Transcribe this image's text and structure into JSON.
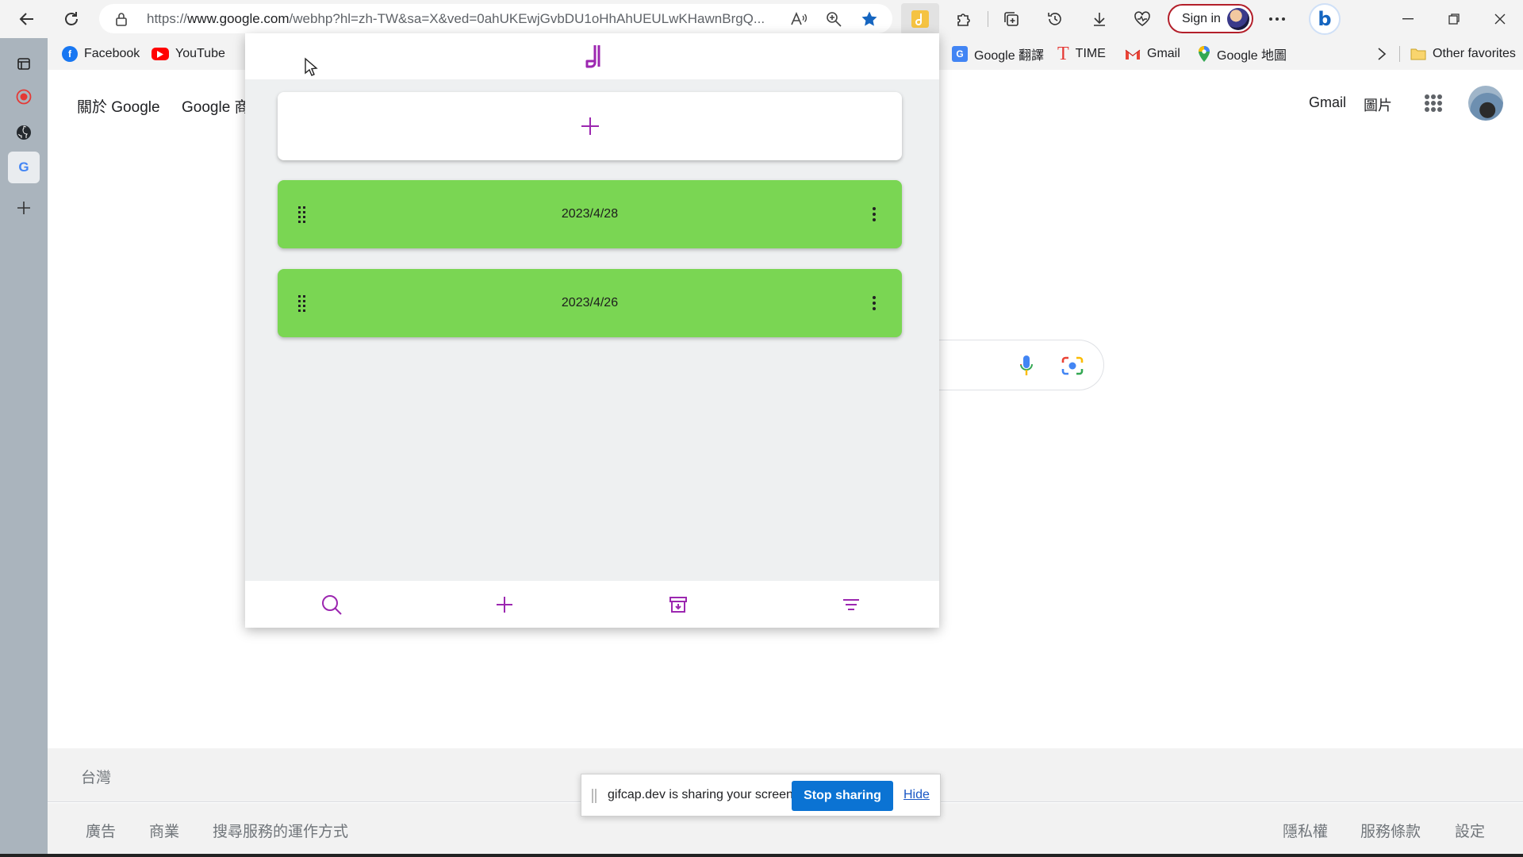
{
  "browser": {
    "url_prefix": "https://",
    "url_host": "www.google.com",
    "url_rest": "/webhp?hl=zh-TW&sa=X&ved=0ahUKEwjGvbDU1oHhAhUEULwKHawnBrgQ...",
    "sign_in_label": "Sign in",
    "bing_label": "b",
    "icons": {
      "back": "back-arrow-icon",
      "reload": "reload-icon",
      "lock": "lock-icon",
      "read_aloud": "read-aloud-icon",
      "zoom": "zoom-icon",
      "favorite": "star-icon",
      "extension": "extension-icon",
      "extensions": "puzzle-icon",
      "collections": "collections-icon",
      "history": "history-icon",
      "downloads": "download-icon",
      "performance": "heartbeat-icon",
      "more": "more-icon",
      "minimize": "minimize-icon",
      "restore": "restore-icon",
      "close": "close-icon"
    }
  },
  "favorites": {
    "items": [
      {
        "label": "Facebook",
        "icon": "facebook-icon"
      },
      {
        "label": "YouTube",
        "icon": "youtube-icon"
      },
      {
        "label": "Google 翻譯",
        "icon": "google-translate-icon"
      },
      {
        "label": "TIME",
        "icon": "time-icon"
      },
      {
        "label": "Gmail",
        "icon": "gmail-icon"
      },
      {
        "label": "Google 地圖",
        "icon": "google-maps-icon"
      }
    ],
    "other_label": "Other favorites"
  },
  "google": {
    "top_left_links": [
      "關於 Google",
      "Google 商"
    ],
    "top_right_links": [
      "Gmail",
      "圖片"
    ],
    "footer_country": "台灣",
    "footer_left": [
      "廣告",
      "商業",
      "搜尋服務的運作方式"
    ],
    "footer_right": [
      "隱私權",
      "服務條款",
      "設定"
    ]
  },
  "popup": {
    "accent_color": "#9c27b0",
    "note_color": "#7ad653",
    "notes": [
      {
        "title": "2023/4/28"
      },
      {
        "title": "2023/4/26"
      }
    ]
  },
  "sharebar": {
    "message": "gifcap.dev is sharing your screen.",
    "stop_label": "Stop sharing",
    "hide_label": "Hide"
  }
}
